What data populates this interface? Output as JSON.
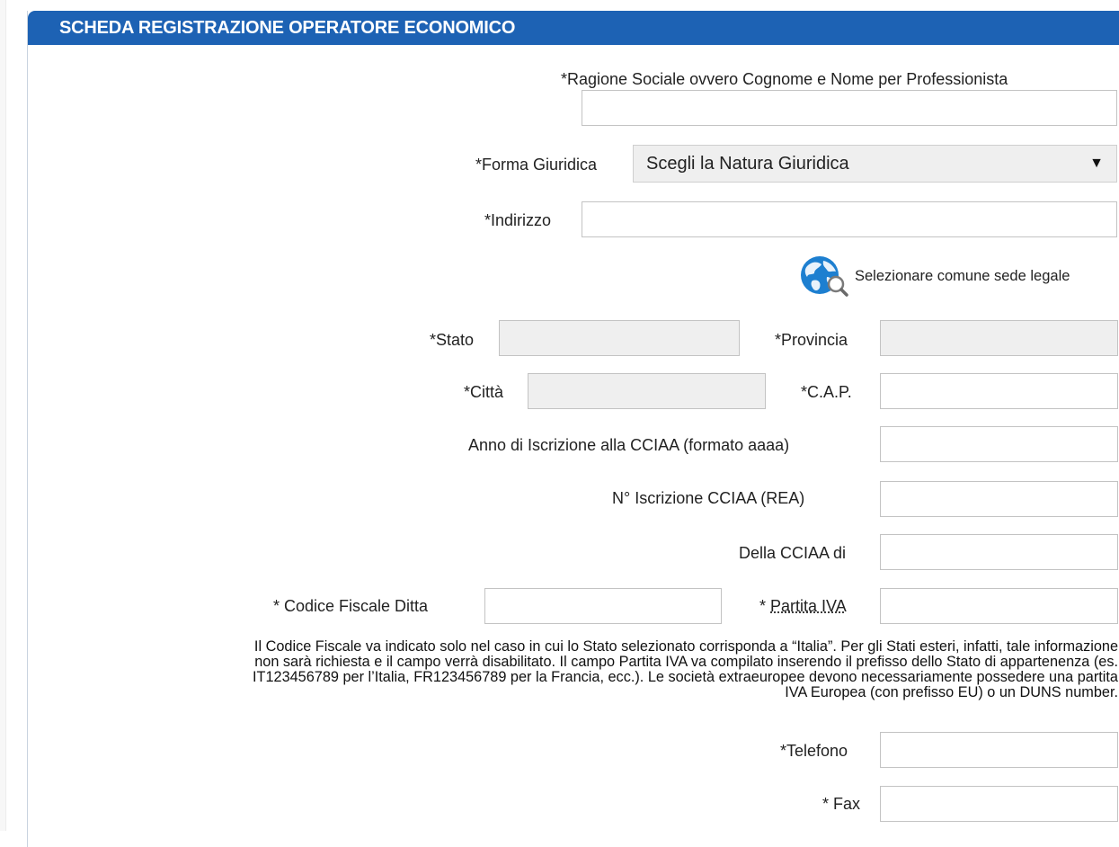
{
  "panel": {
    "title": "SCHEDA REGISTRAZIONE OPERATORE ECONOMICO"
  },
  "form": {
    "ragione_sociale_label": "*Ragione Sociale ovvero Cognome e Nome per Professionista",
    "ragione_sociale_value": "",
    "forma_giuridica_label": "*Forma Giuridica",
    "forma_giuridica_selected": "Scegli la Natura Giuridica",
    "indirizzo_label": "*Indirizzo",
    "indirizzo_value": "",
    "comune_link_label": "Selezionare comune sede legale",
    "stato_label": "*Stato",
    "provincia_label": "*Provincia",
    "citta_label": "*Città",
    "cap_label": "*C.A.P.",
    "anno_cciaa_label": "Anno di Iscrizione alla CCIAA (formato aaaa)",
    "n_cciaa_label": "N° Iscrizione CCIAA (REA)",
    "della_cciaa_label": "Della CCIAA di",
    "codice_fiscale_label": "* Codice Fiscale Ditta",
    "partita_iva_prefix": "* ",
    "partita_iva_label": "Partita IVA",
    "note_line1": "Il Codice Fiscale va indicato solo nel caso in cui lo Stato selezionato corrisponda a “Italia”. Per gli Stati esteri, infatti, tale informazione",
    "note_line2": "non sarà richiesta e il campo verrà disabilitato. Il campo Partita IVA va compilato inserendo il prefisso dello Stato di appartenenza (es.",
    "note_line3": "IT123456789 per l’Italia, FR123456789 per la Francia, ecc.). Le società extraeuropee devono necessariamente possedere una partita",
    "note_line4": "IVA Europea (con prefisso EU) o un DUNS number.",
    "telefono_label": "*Telefono",
    "fax_label": "* Fax"
  },
  "icons": {
    "comune_lookup": "globe-search-icon",
    "dropdown": "triangle-down-icon"
  },
  "colors": {
    "header": "#1d62b4",
    "disabled_field": "#efefef"
  }
}
